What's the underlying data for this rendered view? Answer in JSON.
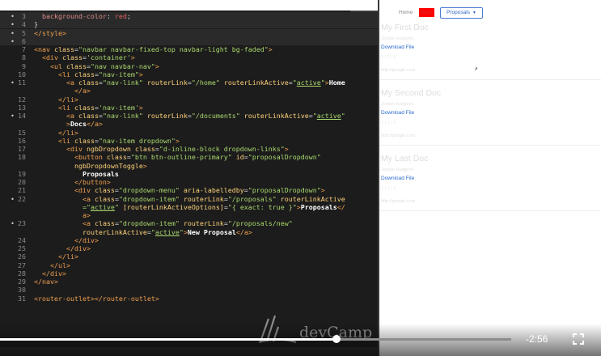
{
  "editor": {
    "lines": [
      {
        "n": "3",
        "dot": true,
        "parts": [
          [
            "prop",
            "  background-color"
          ],
          [
            "plain",
            ": "
          ],
          [
            "kw",
            "red"
          ],
          [
            "plain",
            ";"
          ]
        ]
      },
      {
        "n": "4",
        "dot": true,
        "parts": [
          [
            "plain",
            "}"
          ]
        ]
      },
      {
        "n": "5",
        "dot": true,
        "parts": [
          [
            "tag",
            "</style>"
          ]
        ]
      },
      {
        "n": "6",
        "dot": true,
        "parts": []
      },
      {
        "n": "7",
        "dot": false,
        "parts": [
          [
            "tag",
            "<nav "
          ],
          [
            "attr",
            "class"
          ],
          [
            "plain",
            "="
          ],
          [
            "str",
            "\"navbar navbar-fixed-top navbar-light bg-faded\""
          ],
          [
            "tag",
            ">"
          ]
        ]
      },
      {
        "n": "8",
        "dot": false,
        "parts": [
          [
            "plain",
            "  "
          ],
          [
            "tag",
            "<div "
          ],
          [
            "attr",
            "class"
          ],
          [
            "plain",
            "="
          ],
          [
            "str",
            "'container'"
          ],
          [
            "tag",
            ">"
          ]
        ]
      },
      {
        "n": "9",
        "dot": false,
        "parts": [
          [
            "plain",
            "    "
          ],
          [
            "tag",
            "<ul "
          ],
          [
            "attr",
            "class"
          ],
          [
            "plain",
            "="
          ],
          [
            "str",
            "\"nav navbar-nav\""
          ],
          [
            "tag",
            ">"
          ]
        ]
      },
      {
        "n": "10",
        "dot": false,
        "parts": [
          [
            "plain",
            "      "
          ],
          [
            "tag",
            "<li "
          ],
          [
            "attr",
            "class"
          ],
          [
            "plain",
            "="
          ],
          [
            "str",
            "\"nav-item\""
          ],
          [
            "tag",
            ">"
          ]
        ]
      },
      {
        "n": "11",
        "dot": true,
        "parts": [
          [
            "plain",
            "        "
          ],
          [
            "tag",
            "<a "
          ],
          [
            "attr",
            "class"
          ],
          [
            "plain",
            "="
          ],
          [
            "str",
            "\"nav-link\" "
          ],
          [
            "attr",
            "routerLink"
          ],
          [
            "plain",
            "="
          ],
          [
            "str",
            "\"/home\" "
          ],
          [
            "attr",
            "routerLinkActive"
          ],
          [
            "plain",
            "="
          ],
          [
            "str",
            "\""
          ],
          [
            "act",
            "active"
          ],
          [
            "str",
            "\""
          ],
          [
            "tag",
            ">"
          ],
          [
            "txt",
            "Home"
          ]
        ]
      },
      {
        "n": "",
        "dot": false,
        "parts": [
          [
            "plain",
            "          "
          ],
          [
            "tag",
            "</a>"
          ]
        ]
      },
      {
        "n": "12",
        "dot": false,
        "parts": [
          [
            "plain",
            "      "
          ],
          [
            "tag",
            "</li>"
          ]
        ]
      },
      {
        "n": "13",
        "dot": false,
        "parts": [
          [
            "plain",
            "      "
          ],
          [
            "tag",
            "<li "
          ],
          [
            "attr",
            "class"
          ],
          [
            "plain",
            "="
          ],
          [
            "str",
            "'nav-item'"
          ],
          [
            "tag",
            ">"
          ]
        ]
      },
      {
        "n": "14",
        "dot": true,
        "parts": [
          [
            "plain",
            "        "
          ],
          [
            "tag",
            "<a "
          ],
          [
            "attr",
            "class"
          ],
          [
            "plain",
            "="
          ],
          [
            "str",
            "\"nav-link\" "
          ],
          [
            "attr",
            "routerLink"
          ],
          [
            "plain",
            "="
          ],
          [
            "str",
            "\"/documents\" "
          ],
          [
            "attr",
            "routerLinkActive"
          ],
          [
            "plain",
            "="
          ],
          [
            "str",
            "\""
          ],
          [
            "act",
            "active"
          ],
          [
            "str",
            "\""
          ]
        ]
      },
      {
        "n": "",
        "dot": false,
        "parts": [
          [
            "plain",
            "        "
          ],
          [
            "tag",
            ">"
          ],
          [
            "txt",
            "Docs"
          ],
          [
            "tag",
            "</a>"
          ]
        ]
      },
      {
        "n": "15",
        "dot": false,
        "parts": [
          [
            "plain",
            "      "
          ],
          [
            "tag",
            "</li>"
          ]
        ]
      },
      {
        "n": "16",
        "dot": false,
        "parts": [
          [
            "plain",
            "      "
          ],
          [
            "tag",
            "<li "
          ],
          [
            "attr",
            "class"
          ],
          [
            "plain",
            "="
          ],
          [
            "str",
            "\"nav-item dropdown\""
          ],
          [
            "tag",
            ">"
          ]
        ]
      },
      {
        "n": "17",
        "dot": false,
        "parts": [
          [
            "plain",
            "        "
          ],
          [
            "tag",
            "<div "
          ],
          [
            "attr",
            "ngbDropdown class"
          ],
          [
            "plain",
            "="
          ],
          [
            "str",
            "\"d-inline-block dropdown-links\""
          ],
          [
            "tag",
            ">"
          ]
        ]
      },
      {
        "n": "18",
        "dot": false,
        "parts": [
          [
            "plain",
            "          "
          ],
          [
            "tag",
            "<button "
          ],
          [
            "attr",
            "class"
          ],
          [
            "plain",
            "="
          ],
          [
            "str",
            "\"btn btn-outline-primary\" "
          ],
          [
            "attr",
            "id"
          ],
          [
            "plain",
            "="
          ],
          [
            "str",
            "\"proposalDropdown\""
          ]
        ]
      },
      {
        "n": "",
        "dot": false,
        "parts": [
          [
            "plain",
            "          "
          ],
          [
            "attr",
            "ngbDropdownToggle"
          ],
          [
            "tag",
            ">"
          ]
        ]
      },
      {
        "n": "19",
        "dot": false,
        "parts": [
          [
            "plain",
            "            "
          ],
          [
            "txt",
            "Proposals"
          ]
        ]
      },
      {
        "n": "20",
        "dot": false,
        "parts": [
          [
            "plain",
            "          "
          ],
          [
            "tag",
            "</button>"
          ]
        ]
      },
      {
        "n": "21",
        "dot": false,
        "parts": [
          [
            "plain",
            "          "
          ],
          [
            "tag",
            "<div "
          ],
          [
            "attr",
            "class"
          ],
          [
            "plain",
            "="
          ],
          [
            "str",
            "\"dropdown-menu\" "
          ],
          [
            "attr",
            "aria-labelledby"
          ],
          [
            "plain",
            "="
          ],
          [
            "str",
            "\"proposalDropdown\""
          ],
          [
            "tag",
            ">"
          ]
        ]
      },
      {
        "n": "22",
        "dot": true,
        "parts": [
          [
            "plain",
            "            "
          ],
          [
            "tag",
            "<a "
          ],
          [
            "attr",
            "class"
          ],
          [
            "plain",
            "="
          ],
          [
            "str",
            "\"dropdown-item\" "
          ],
          [
            "attr",
            "routerLink"
          ],
          [
            "plain",
            "="
          ],
          [
            "str",
            "\"/proposals\" "
          ],
          [
            "attr",
            "routerLinkActive"
          ]
        ]
      },
      {
        "n": "",
        "dot": false,
        "parts": [
          [
            "plain",
            "            "
          ],
          [
            "str",
            "=\""
          ],
          [
            "act",
            "active"
          ],
          [
            "str",
            "\" "
          ],
          [
            "attr",
            "[routerLinkActiveOptions]"
          ],
          [
            "plain",
            "="
          ],
          [
            "str",
            "\"{ exact: true }\""
          ],
          [
            "tag",
            ">"
          ],
          [
            "txt",
            "Proposals"
          ],
          [
            "tag",
            "</"
          ]
        ]
      },
      {
        "n": "",
        "dot": false,
        "parts": [
          [
            "plain",
            "            "
          ],
          [
            "tag",
            "a>"
          ]
        ]
      },
      {
        "n": "23",
        "dot": true,
        "parts": [
          [
            "plain",
            "            "
          ],
          [
            "tag",
            "<a "
          ],
          [
            "attr",
            "class"
          ],
          [
            "plain",
            "="
          ],
          [
            "str",
            "\"dropdown-item\" "
          ],
          [
            "attr",
            "routerLink"
          ],
          [
            "plain",
            "="
          ],
          [
            "str",
            "\"/proposals/new\""
          ]
        ]
      },
      {
        "n": "",
        "dot": false,
        "parts": [
          [
            "plain",
            "            "
          ],
          [
            "attr",
            "routerLinkActive"
          ],
          [
            "plain",
            "="
          ],
          [
            "str",
            "\""
          ],
          [
            "act",
            "active"
          ],
          [
            "str",
            "\""
          ],
          [
            "tag",
            ">"
          ],
          [
            "txt",
            "New Proposal"
          ],
          [
            "tag",
            "</a>"
          ]
        ]
      },
      {
        "n": "24",
        "dot": false,
        "parts": [
          [
            "plain",
            "          "
          ],
          [
            "tag",
            "</div>"
          ]
        ]
      },
      {
        "n": "25",
        "dot": false,
        "parts": [
          [
            "plain",
            "        "
          ],
          [
            "tag",
            "</div>"
          ]
        ]
      },
      {
        "n": "26",
        "dot": false,
        "parts": [
          [
            "plain",
            "      "
          ],
          [
            "tag",
            "</li>"
          ]
        ]
      },
      {
        "n": "27",
        "dot": false,
        "parts": [
          [
            "plain",
            "    "
          ],
          [
            "tag",
            "</ul>"
          ]
        ]
      },
      {
        "n": "28",
        "dot": false,
        "parts": [
          [
            "plain",
            "  "
          ],
          [
            "tag",
            "</div>"
          ]
        ]
      },
      {
        "n": "29",
        "dot": false,
        "parts": [
          [
            "tag",
            "</nav>"
          ]
        ]
      },
      {
        "n": "30",
        "dot": false,
        "parts": []
      },
      {
        "n": "31",
        "dot": false,
        "parts": [
          [
            "tag",
            "<router-outlet></router-outlet>"
          ]
        ]
      }
    ]
  },
  "watermark": {
    "brand": "devCamp"
  },
  "browser": {
    "nav": {
      "home": "Home",
      "docs": "Docs",
      "proposals": "Proposals"
    },
    "docs": [
      {
        "title": "My First Doc",
        "meta": "Jordan Hudgens",
        "link": "Download File",
        "small": "1 / 1 / 1",
        "url": "http://google.com"
      },
      {
        "title": "My Second Doc",
        "meta": "Jordan Hudgens",
        "link": "Download File",
        "small": "1 / 1 / 1",
        "url": "http://google.com"
      },
      {
        "title": "My Last Doc",
        "meta": "Jordan Hudgens",
        "link": "Download File",
        "small": "1 / 1 / 1",
        "url": "http://google.com"
      }
    ]
  },
  "player": {
    "time_remaining": "-2:56",
    "progress": 0.658
  },
  "colors": {
    "docs_highlight": "#ff0000",
    "link": "#2a6cd0",
    "editor_bg": "#1c1c1c"
  }
}
